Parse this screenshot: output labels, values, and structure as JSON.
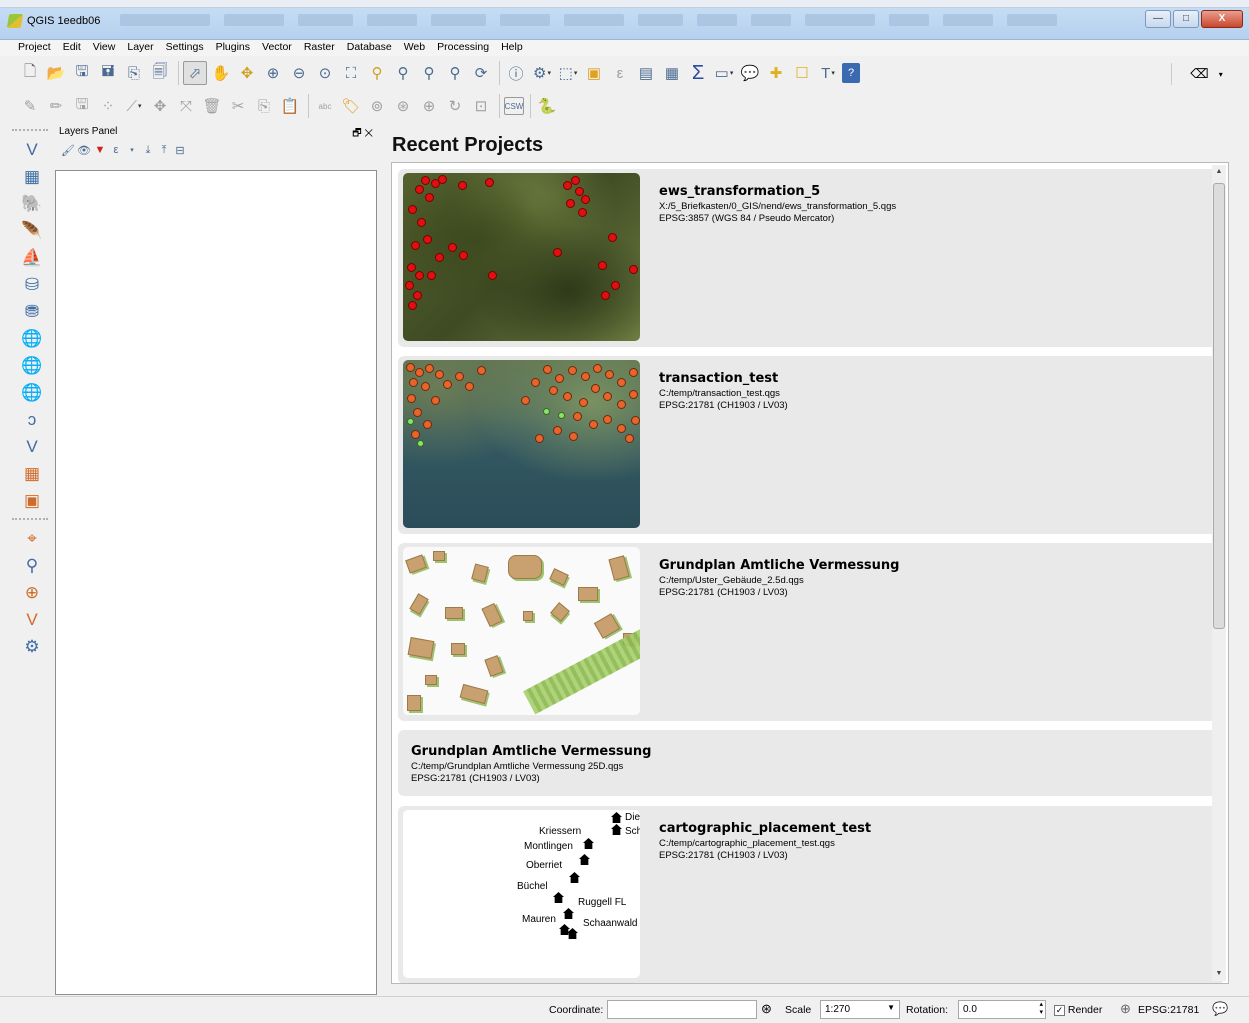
{
  "window": {
    "title": "QGIS 1eedb06",
    "buttons": {
      "minimize": "—",
      "maximize": "□",
      "close": "X"
    }
  },
  "menu": [
    "Project",
    "Edit",
    "View",
    "Layer",
    "Settings",
    "Plugins",
    "Vector",
    "Raster",
    "Database",
    "Web",
    "Processing",
    "Help"
  ],
  "toolbar": {
    "row1_icons": [
      "new-project-icon",
      "open-project-icon",
      "save-project-icon",
      "save-as-icon",
      "new-print-composer-icon",
      "composer-manager-icon",
      "touch-zoom-icon",
      "pan-icon",
      "pan-to-selection-icon",
      "zoom-in-icon",
      "zoom-out-icon",
      "zoom-native-icon",
      "zoom-full-icon",
      "zoom-to-selection-icon",
      "zoom-to-layer-icon",
      "zoom-last-icon",
      "zoom-next-icon",
      "refresh-icon",
      "identify-icon",
      "run-action-icon",
      "select-features-icon",
      "deselect-icon",
      "select-expression-icon",
      "attribute-table-icon",
      "field-calculator-icon",
      "statistics-icon",
      "measure-icon",
      "map-tips-icon",
      "new-bookmark-icon",
      "show-bookmarks-icon",
      "text-annotation-icon",
      "help-icon"
    ],
    "csw_label": "CSW",
    "abc_label": "abc"
  },
  "layers_panel": {
    "title": "Layers Panel",
    "float_glyph": "🗗",
    "close_glyph": "✕"
  },
  "recent_projects": {
    "heading": "Recent Projects",
    "items": [
      {
        "name": "ews_transformation_5",
        "path": "X:/5_Briefkasten/0_GIS/nend/ews_transformation_5.qgs",
        "crs": "EPSG:3857 (WGS 84 / Pseudo Mercator)"
      },
      {
        "name": "transaction_test",
        "path": "C:/temp/transaction_test.qgs",
        "crs": "EPSG:21781 (CH1903 / LV03)"
      },
      {
        "name": "Grundplan Amtliche Vermessung",
        "path": "C:/temp/Uster_Gebäude_2.5d.qgs",
        "crs": "EPSG:21781 (CH1903 / LV03)"
      },
      {
        "name": "Grundplan Amtliche Vermessung",
        "path": "C:/temp/Grundplan Amtliche Vermessung 25D.qgs",
        "crs": "EPSG:21781 (CH1903 / LV03)"
      },
      {
        "name": "cartographic_placement_test",
        "path": "C:/temp/cartographic_placement_test.qgs",
        "crs": "EPSG:21781 (CH1903 / LV03)"
      }
    ],
    "places": [
      "Kriessern",
      "Montlingen",
      "Oberriet",
      "Büchel",
      "Ruggell FL",
      "Mauren",
      "Schaanwald",
      "Die",
      "Sch"
    ]
  },
  "statusbar": {
    "coordinate_label": "Coordinate:",
    "coordinate_value": "",
    "scale_label": "Scale",
    "scale_value": "1:270",
    "rotation_label": "Rotation:",
    "rotation_value": "0.0",
    "render_label": "Render",
    "crs_label": "EPSG:21781"
  }
}
